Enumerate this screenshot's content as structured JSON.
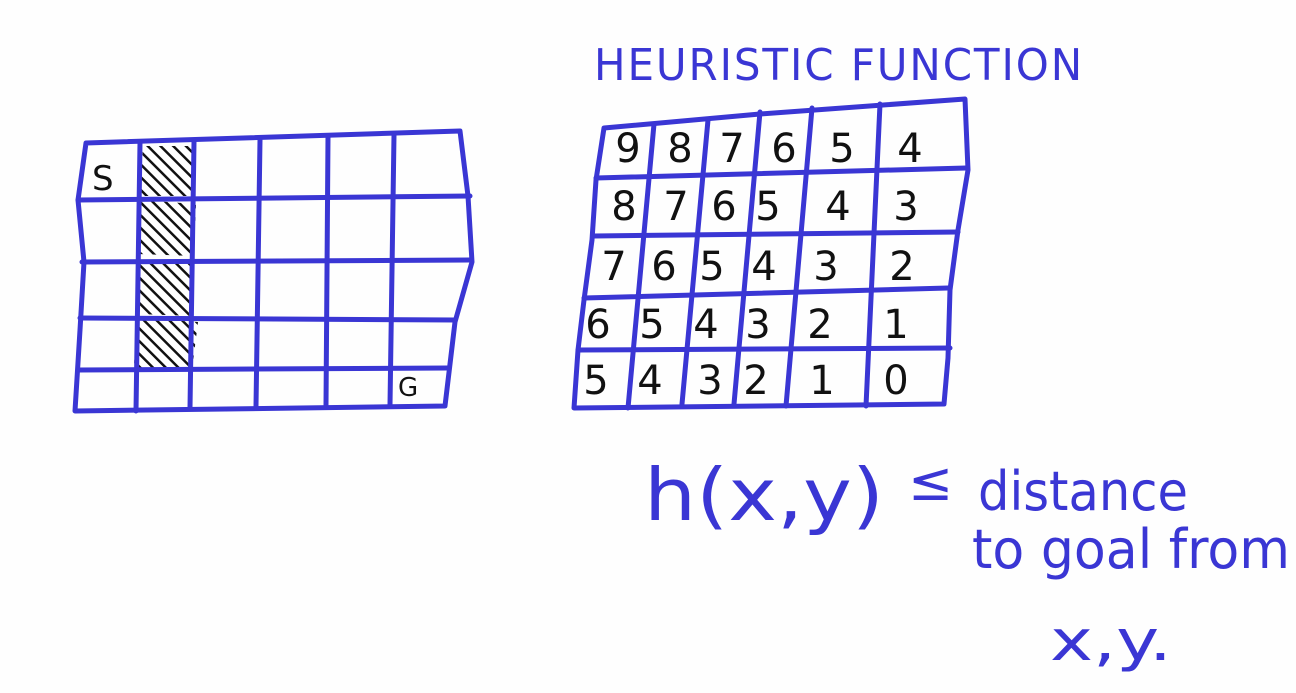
{
  "ink_color": "#3a36d4",
  "text_color": "#111111",
  "left_grid": {
    "rows": 5,
    "cols": 6,
    "start_label": "S",
    "goal_label": "G",
    "blocked_cells": [
      [
        0,
        1
      ],
      [
        1,
        1
      ],
      [
        2,
        1
      ],
      [
        3,
        1
      ]
    ],
    "start_cell": [
      0,
      0
    ],
    "goal_cell": [
      4,
      5
    ]
  },
  "heuristic": {
    "title": "HEURISTIC FUNCTION",
    "rows": 5,
    "cols": 6,
    "values": [
      [
        "9",
        "8",
        "7",
        "6",
        "5",
        "4"
      ],
      [
        "8",
        "7",
        "6",
        "5",
        "4",
        "3"
      ],
      [
        "7",
        "6",
        "5",
        "4",
        "3",
        "2"
      ],
      [
        "6",
        "5",
        "4",
        "3",
        "2",
        "1"
      ],
      [
        "5",
        "4",
        "3",
        "2",
        "1",
        "0"
      ]
    ]
  },
  "formula": {
    "lhs": "h(x,y)",
    "relation": "≤",
    "line1": "distance",
    "line2": "to goal from",
    "line3": "x,y."
  }
}
